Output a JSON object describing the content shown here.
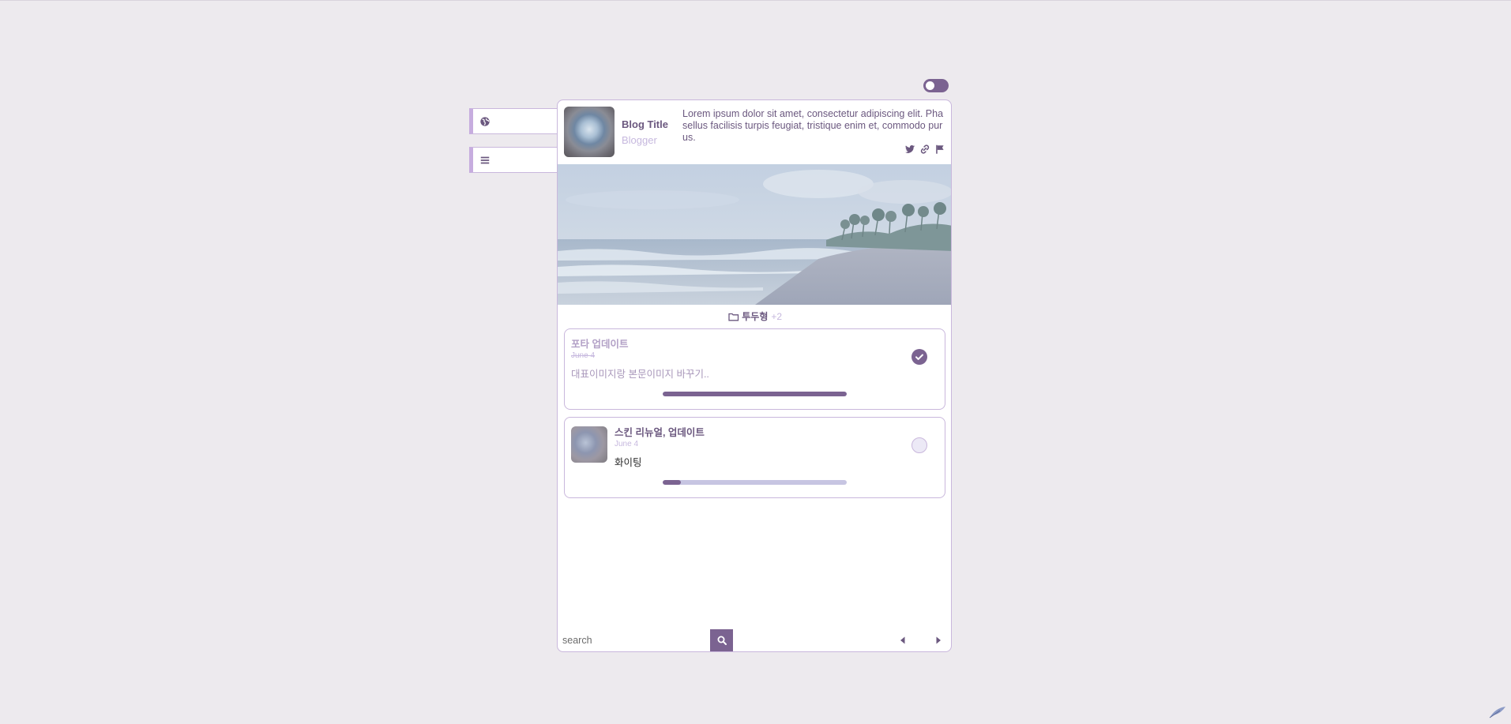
{
  "profile": {
    "title": "Blog Title",
    "role": "Blogger",
    "description": "Lorem ipsum dolor sit amet, consectetur adipiscing elit. Phasellus facilisis turpis feugiat, tristique enim et, commodo purus."
  },
  "category": {
    "label": "투두형",
    "extra": "+2"
  },
  "posts": [
    {
      "title": "포타 업데이트",
      "date": "June 4",
      "excerpt": "대표이미지랑 본문이미지 바꾸기..",
      "done": true,
      "progress": 1.0
    },
    {
      "title": "스킨 리뉴얼, 업데이트",
      "date": "June 4",
      "excerpt": "화이팅",
      "done": false,
      "progress": 0.1
    }
  ],
  "search": {
    "placeholder": "search"
  },
  "colors": {
    "accent": "#7b6391",
    "muted": "#c6b8de",
    "background": "#edeaee",
    "border": "#c9b7dc"
  },
  "icons": {
    "side_tab_1": "globe-icon",
    "side_tab_2": "menu-icon",
    "social": [
      "twitter-icon",
      "link-icon",
      "flag-icon"
    ],
    "category": "folder-icon",
    "search": "search-icon",
    "nav": [
      "caret-left-icon",
      "caret-right-icon"
    ]
  }
}
